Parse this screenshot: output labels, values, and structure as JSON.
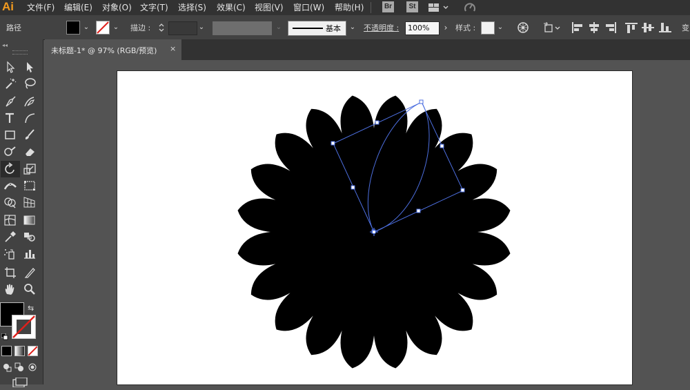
{
  "app": {
    "logo": "Ai"
  },
  "menu": [
    "文件(F)",
    "编辑(E)",
    "对象(O)",
    "文字(T)",
    "选择(S)",
    "效果(C)",
    "视图(V)",
    "窗口(W)",
    "帮助(H)"
  ],
  "menubar_badges": {
    "bridge": "Br",
    "stock": "St"
  },
  "control": {
    "selection_type": "路径",
    "stroke_label": "描边 :",
    "brush_label": "基本",
    "opacity_label": "不透明度 :",
    "opacity_value": "100%",
    "style_label": "样式 :",
    "truncated_label": "变"
  },
  "document_tab": {
    "title": "未标题-1* @ 97% (RGB/预览)",
    "close": "×"
  },
  "colors": {
    "menubar_bg": "#323232",
    "control_bg": "#424242",
    "workspace_bg": "#535353",
    "artboard_bg": "#ffffff",
    "shape_fill": "#000000",
    "selection": "#4d6fe0",
    "logo": "#f29a1f"
  },
  "tools": [
    "selection-tool",
    "direct-selection-tool",
    "magic-wand-tool",
    "lasso-tool",
    "pen-tool",
    "curvature-tool",
    "type-tool",
    "arc-tool",
    "rectangle-tool",
    "paintbrush-tool",
    "shaper-tool",
    "eraser-tool",
    "rotate-tool",
    "scale-tool",
    "width-tool",
    "free-transform-tool",
    "shape-builder-tool",
    "perspective-grid-tool",
    "mesh-tool",
    "gradient-tool",
    "eyedropper-tool",
    "blend-tool",
    "symbol-sprayer-tool",
    "column-graph-tool",
    "artboard-tool",
    "slice-tool",
    "hand-tool",
    "zoom-tool"
  ],
  "artwork": {
    "shape": "20-point petal star",
    "petal_count": 20,
    "selected_object": "leaf petal path with bounding box"
  }
}
